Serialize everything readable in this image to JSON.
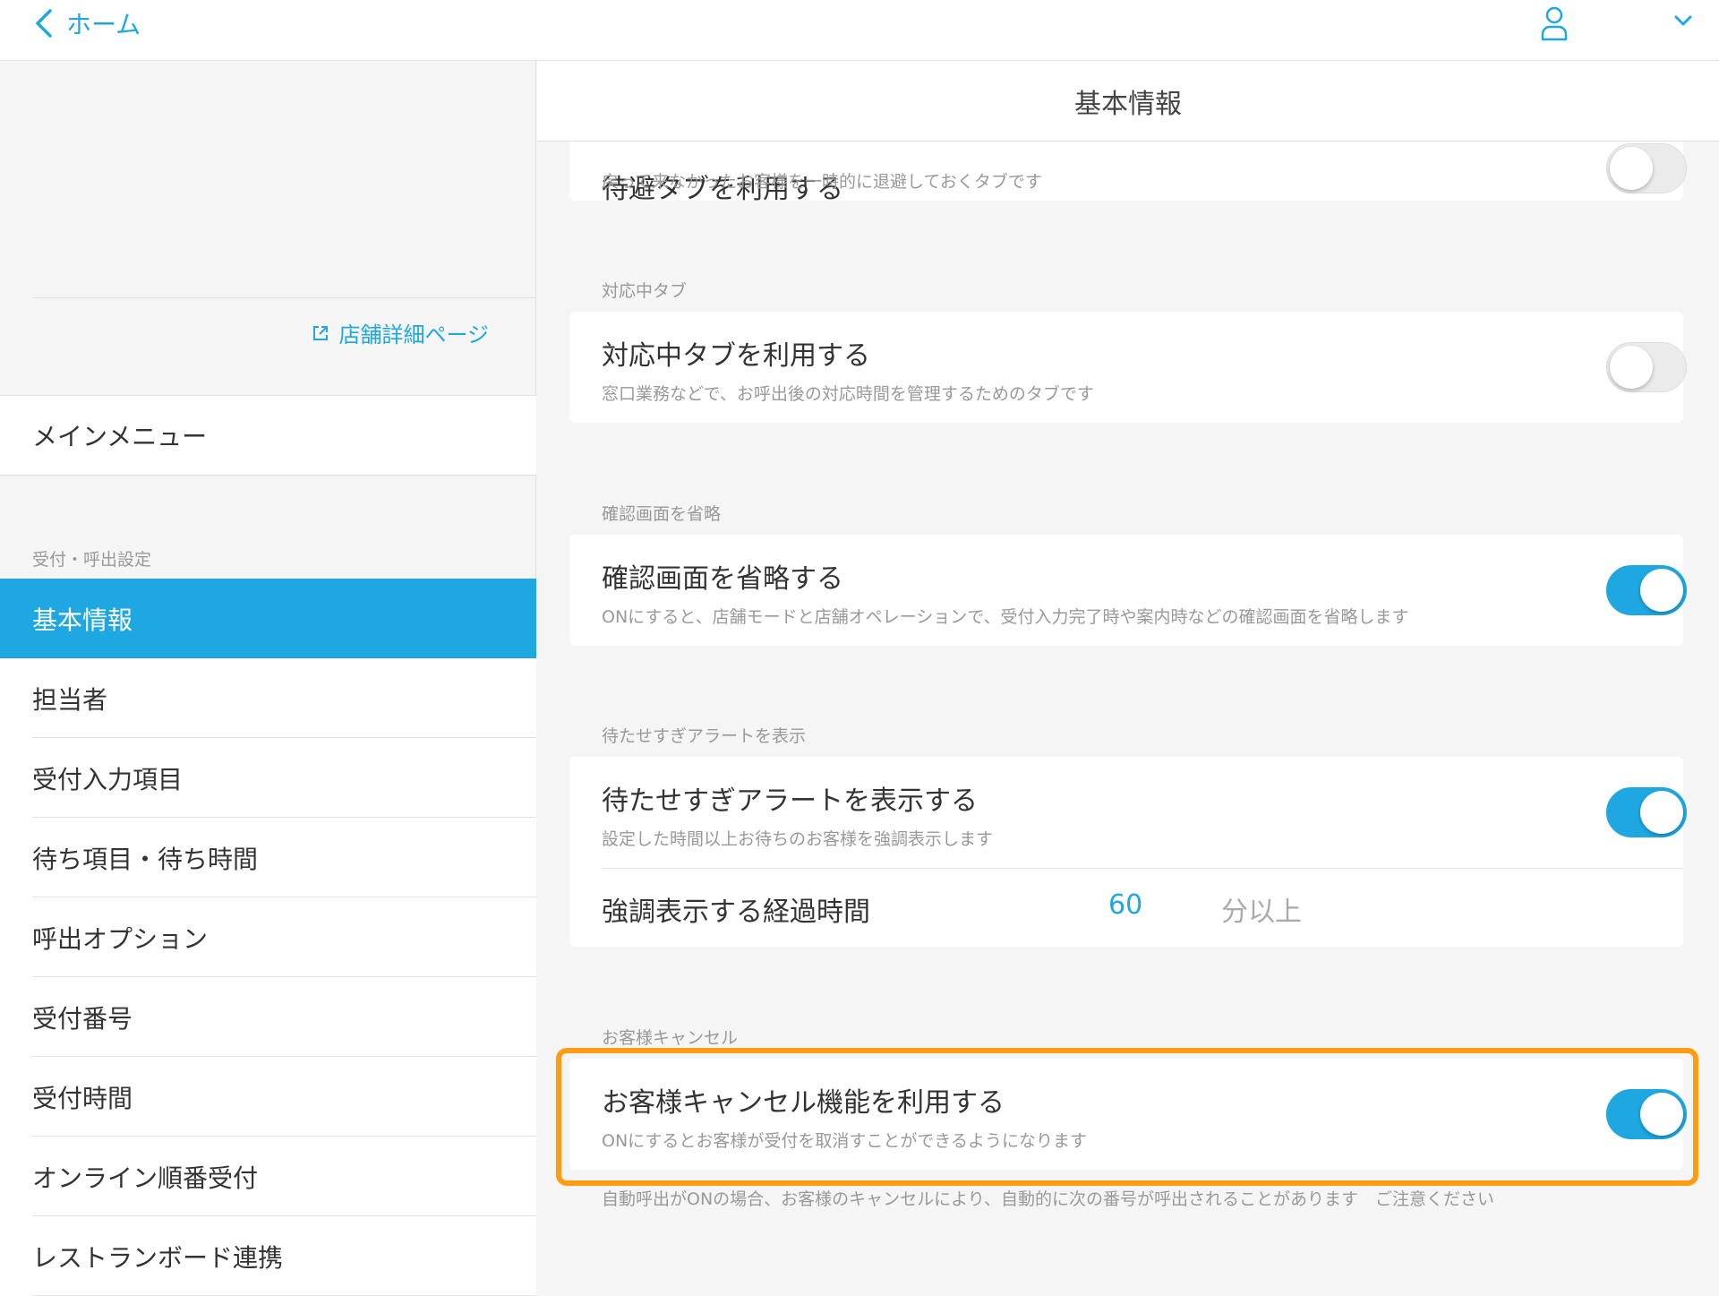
{
  "topbar": {
    "back_label": "ホーム"
  },
  "sidebar": {
    "store_link": "店舗詳細ページ",
    "main_menu": "メインメニュー",
    "section_label": "受付・呼出設定",
    "items": [
      {
        "label": "基本情報",
        "active": true
      },
      {
        "label": "担当者"
      },
      {
        "label": "受付入力項目"
      },
      {
        "label": "待ち項目・待ち時間"
      },
      {
        "label": "呼出オプション"
      },
      {
        "label": "受付番号"
      },
      {
        "label": "受付時間"
      },
      {
        "label": "オンライン順番受付"
      },
      {
        "label": "レストランボード連携"
      }
    ]
  },
  "content": {
    "header_title": "基本情報",
    "card_top": {
      "title_partial": "待避タブを利用する",
      "desc": "戻って来なかったお客様を一時的に退避しておくタブです",
      "toggle": "off"
    },
    "card_taio": {
      "group": "対応中タブ",
      "title": "対応中タブを利用する",
      "desc": "窓口業務などで、お呼出後の対応時間を管理するためのタブです",
      "toggle": "off"
    },
    "card_kakunin": {
      "group": "確認画面を省略",
      "title": "確認画面を省略する",
      "desc": "ONにすると、店舗モードと店舗オペレーションで、受付入力完了時や案内時などの確認画面を省略します",
      "toggle": "on"
    },
    "card_alert": {
      "group": "待たせすぎアラートを表示",
      "title": "待たせすぎアラートを表示する",
      "desc": "設定した時間以上お待ちのお客様を強調表示します",
      "toggle": "on",
      "sub_label": "強調表示する経過時間",
      "sub_value": "60",
      "sub_unit": "分以上"
    },
    "card_cancel": {
      "group": "お客様キャンセル",
      "title": "お客様キャンセル機能を利用する",
      "desc": "ONにするとお客様が受付を取消すことができるようになります",
      "toggle": "on",
      "note": "自動呼出がONの場合、お客様のキャンセルにより、自動的に次の番号が呼出されることがあります　ご注意ください"
    }
  },
  "colors": {
    "accent": "#1ea7e1",
    "highlight": "#ff9d12"
  }
}
